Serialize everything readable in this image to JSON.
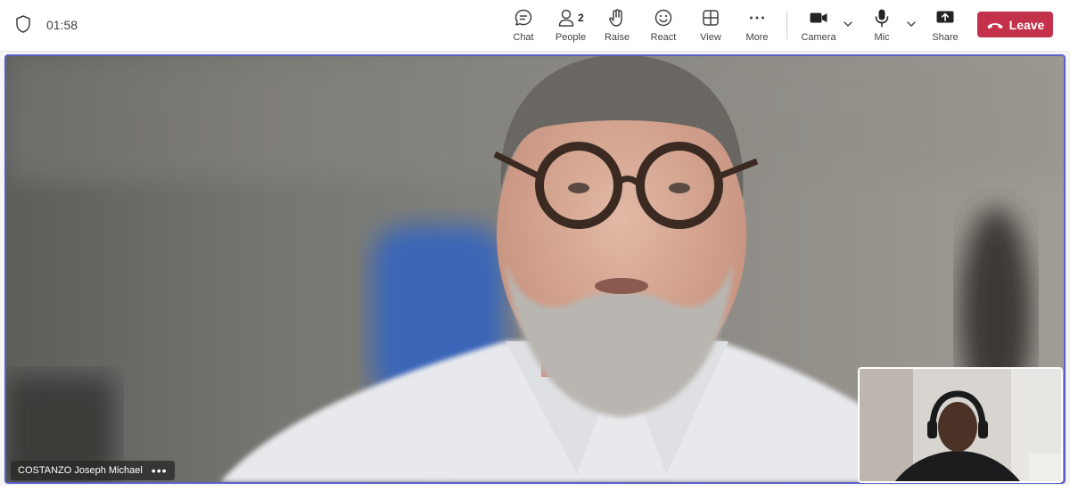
{
  "call": {
    "timer": "01:58"
  },
  "toolbar": {
    "chat": {
      "label": "Chat",
      "icon": "chat-icon"
    },
    "people": {
      "label": "People",
      "count": "2",
      "icon": "people-icon"
    },
    "raise": {
      "label": "Raise",
      "icon": "raise-hand-icon"
    },
    "react": {
      "label": "React",
      "icon": "react-smiley-icon"
    },
    "view": {
      "label": "View",
      "icon": "view-grid-icon"
    },
    "more": {
      "label": "More",
      "icon": "more-dots-icon"
    },
    "camera": {
      "label": "Camera",
      "icon": "camera-icon"
    },
    "mic": {
      "label": "Mic",
      "icon": "mic-icon"
    },
    "share": {
      "label": "Share",
      "icon": "share-screen-icon"
    },
    "leave": {
      "label": "Leave",
      "icon": "hang-up-icon",
      "color": "#c4314b"
    }
  },
  "stage": {
    "participant_name": "COSTANZO Joseph Michael",
    "active_border_color": "#5b5fc7"
  }
}
